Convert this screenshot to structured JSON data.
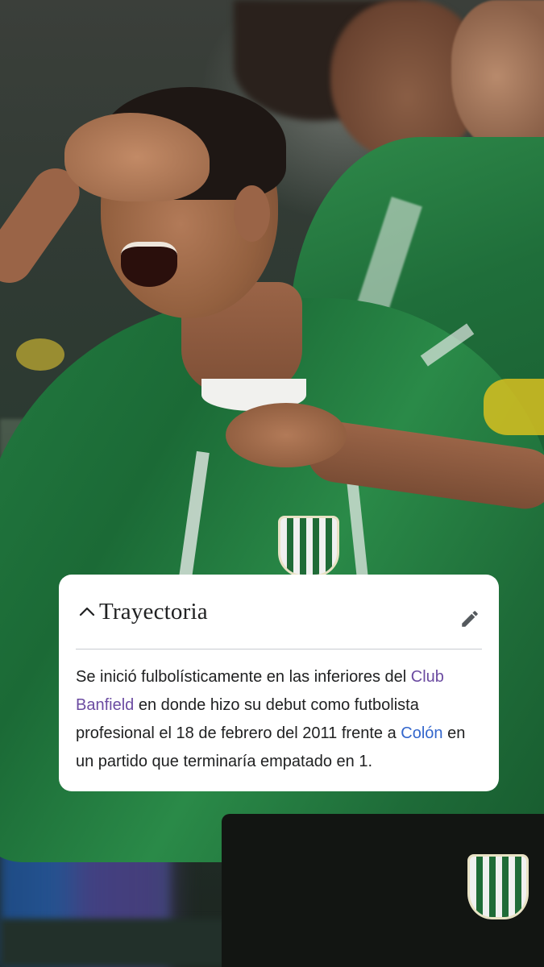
{
  "section": {
    "title": "Trayectoria",
    "collapse_icon": "chevron-up-icon",
    "edit_icon": "pencil-icon"
  },
  "paragraph": {
    "text_1": "Se inició fulbolísticamente en las inferiores del ",
    "link_banfield": "Club Banfield",
    "text_2": " en donde hizo su debut como futbolista profesional el 18 de febrero del 2011 frente a ",
    "link_colon": "Colón",
    "text_3": " en un partido que terminaría empatado en 1."
  },
  "colors": {
    "card_background": "#ffffff",
    "text": "#202122",
    "link": "#3366cc",
    "link_visited": "#6b4ba1",
    "divider": "#c8ccd1"
  }
}
